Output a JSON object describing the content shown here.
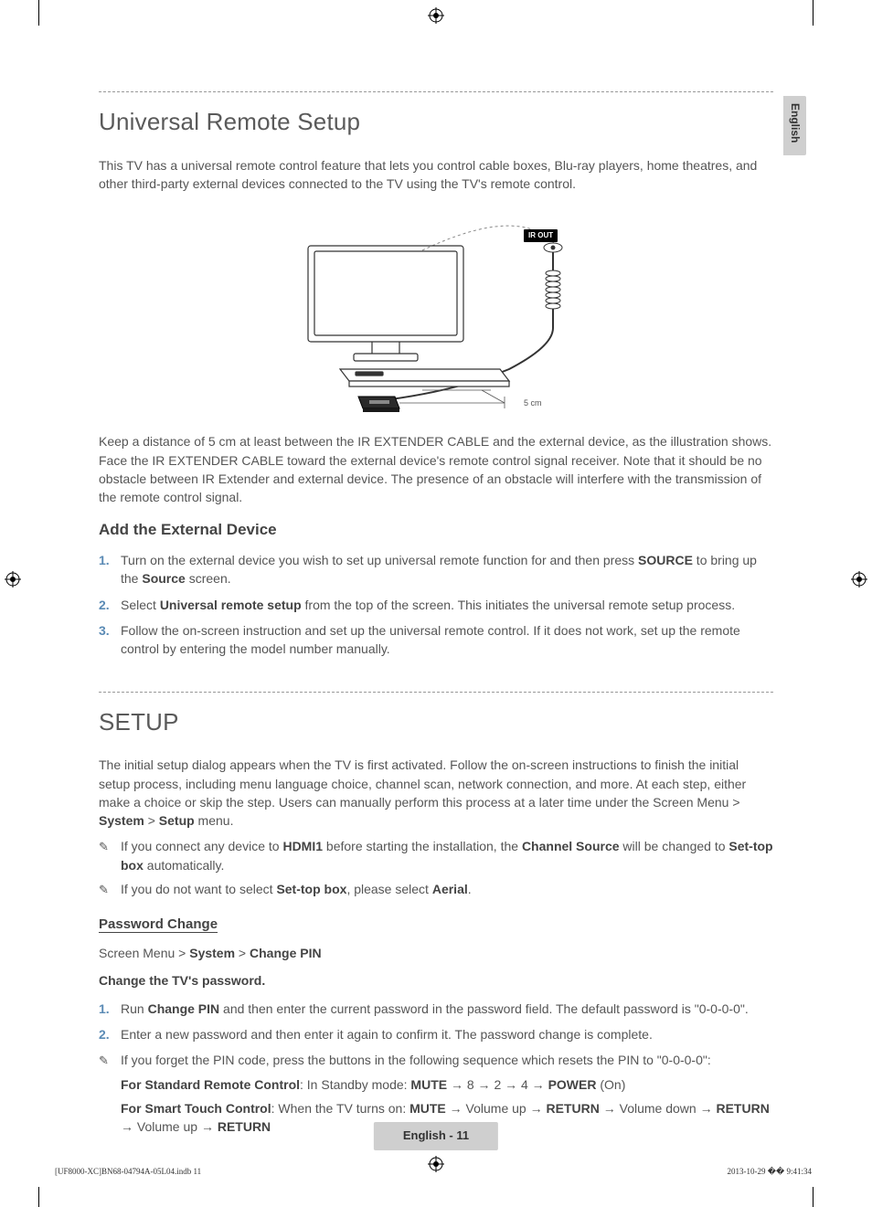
{
  "langTab": "English",
  "section1": {
    "title": "Universal Remote Setup",
    "intro": "This TV has a universal remote control feature that lets you control cable boxes, Blu-ray players, home theatres, and other third-party external devices connected to the TV using the TV's remote control.",
    "irout": "IR OUT",
    "distance": "5 cm",
    "keepDistance": "Keep a distance of 5 cm at least between the IR EXTENDER CABLE and the external device, as the illustration shows. Face the IR EXTENDER CABLE toward the external device's remote control signal receiver. Note that it should be no obstacle between IR Extender and external device. The presence of an obstacle will interfere with the transmission of the remote control signal.",
    "addTitle": "Add the External Device",
    "steps": {
      "s1a": "Turn on the external device you wish to set up universal remote function for and then press ",
      "s1b": "SOURCE",
      "s1c": " to bring up the ",
      "s1d": "Source",
      "s1e": " screen.",
      "s2a": "Select ",
      "s2b": "Universal remote setup",
      "s2c": " from the top of the screen. This initiates the universal remote setup process.",
      "s3": "Follow the on-screen instruction and set up the universal remote control. If it does not work, set up the remote control by entering the model number manually."
    }
  },
  "section2": {
    "title": "SETUP",
    "intro1a": "The initial setup dialog appears when the TV is first activated. Follow the on-screen instructions to finish the initial setup process, including menu language choice, channel scan, network connection, and more. At each step, either make a choice or skip the step. Users can manually perform this process at a later time under the Screen Menu > ",
    "intro1b": "System",
    "intro1c": " > ",
    "intro1d": "Setup",
    "intro1e": " menu.",
    "note1a": "If you connect any device to ",
    "note1b": "HDMI1",
    "note1c": " before starting the installation, the ",
    "note1d": "Channel Source",
    "note1e": " will be changed to ",
    "note1f": "Set-top box",
    "note1g": " automatically.",
    "note2a": "If you do not want to select ",
    "note2b": "Set-top box",
    "note2c": ", please select ",
    "note2d": "Aerial",
    "note2e": ".",
    "pwTitle": "Password Change",
    "pwPath1": "Screen Menu > ",
    "pwPath2": "System",
    "pwPath3": " > ",
    "pwPath4": "Change PIN",
    "pwChange": "Change the TV's password.",
    "pw1a": "Run ",
    "pw1b": "Change PIN",
    "pw1c": " and then enter the current password in the password field. The default password is \"0-0-0-0\".",
    "pw2": "Enter a new password and then enter it again to confirm it. The password change is complete.",
    "pwNote": "If you forget the PIN code, press the buttons in the following sequence which resets the PIN to \"0-0-0-0\":",
    "std1": "For Standard Remote Control",
    "std2": ": In Standby mode: ",
    "std3": "MUTE",
    "std4": " → 8 → 2 → 4 → ",
    "std5": "POWER",
    "std6": " (On)",
    "smt1": "For Smart Touch Control",
    "smt2": ": When the TV turns on: ",
    "smt3": "MUTE",
    "smt4": " → Volume up → ",
    "smt5": "RETURN",
    "smt6": " → Volume down → ",
    "smt7": "RETURN",
    "smt8": " → Volume up → ",
    "smt9": "RETURN"
  },
  "footer": "English - 11",
  "printLeft": "[UF8000-XC]BN68-04794A-05L04.indb   11",
  "printRight": "2013-10-29   �� 9:41:34",
  "nums": {
    "n1": "1.",
    "n2": "2.",
    "n3": "3."
  },
  "noteGlyph": "✎"
}
